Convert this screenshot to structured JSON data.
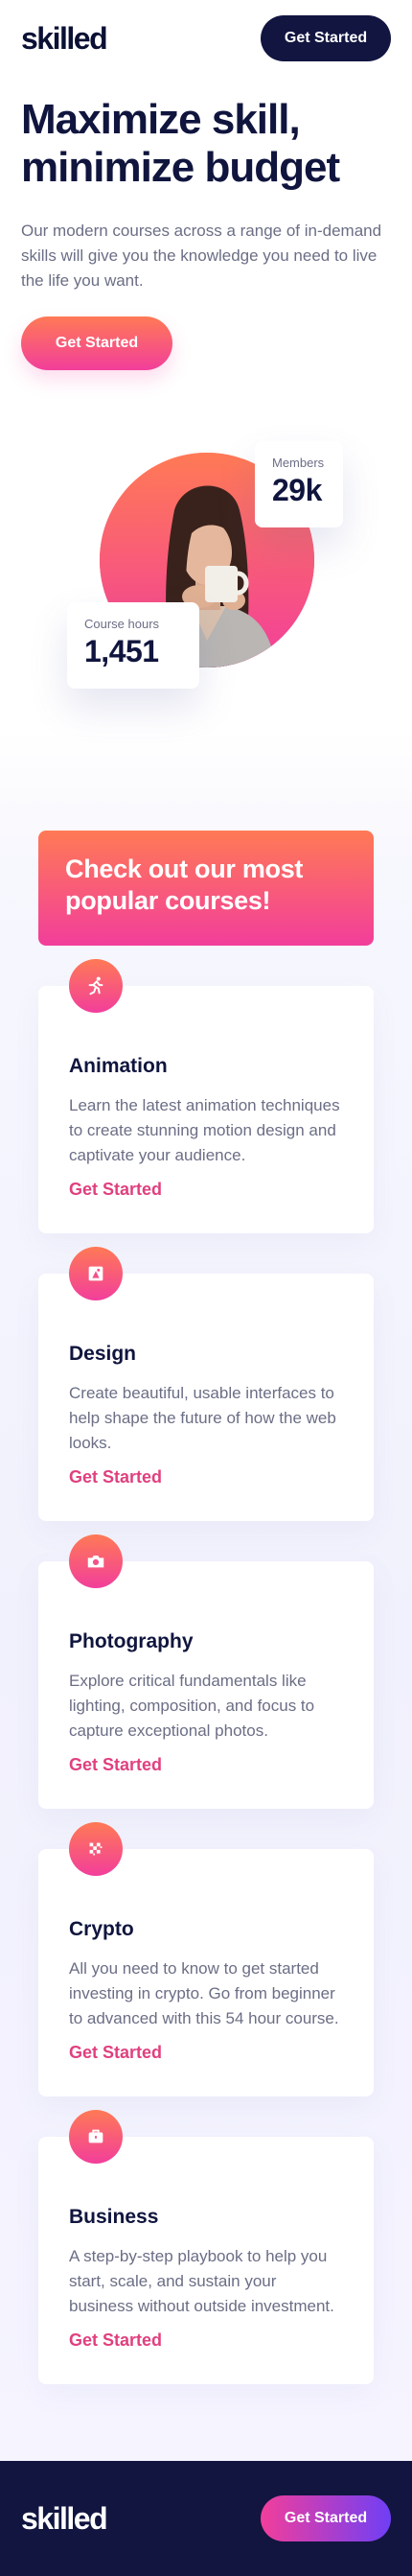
{
  "header": {
    "logo": "skilled",
    "cta_label": "Get Started"
  },
  "hero": {
    "title": "Maximize skill, minimize budget",
    "description": "Our modern courses across a range of in-demand skills will give you the knowledge you need to live the life you want.",
    "cta_label": "Get Started"
  },
  "stats": {
    "members": {
      "label": "Members",
      "value": "29k"
    },
    "course_hours": {
      "label": "Course hours",
      "value": "1,451"
    }
  },
  "courses": {
    "heading": "Check out our most popular courses!",
    "items": [
      {
        "icon": "running-person-icon",
        "title": "Animation",
        "description": "Learn the latest animation techniques to create stunning motion design and captivate your audience.",
        "link": "Get Started"
      },
      {
        "icon": "design-icon",
        "title": "Design",
        "description": "Create beautiful, usable interfaces to help shape the future of how the web looks.",
        "link": "Get Started"
      },
      {
        "icon": "camera-icon",
        "title": "Photography",
        "description": "Explore critical fundamentals like lighting, composition, and focus to capture exceptional photos.",
        "link": "Get Started"
      },
      {
        "icon": "crypto-icon",
        "title": "Crypto",
        "description": "All you need to know to get started investing in crypto. Go from beginner to advanced with this 54 hour course.",
        "link": "Get Started"
      },
      {
        "icon": "briefcase-icon",
        "title": "Business",
        "description": "A step-by-step playbook to help you start, scale, and sustain your business without outside investment.",
        "link": "Get Started"
      }
    ]
  },
  "footer": {
    "logo": "skilled",
    "cta_label": "Get Started"
  },
  "colors": {
    "navy": "#111540",
    "gradient_start": "#ff7a55",
    "gradient_end": "#f23e9b",
    "link_pink": "#e0407f",
    "footer_gradient_end": "#6f3ff5"
  }
}
